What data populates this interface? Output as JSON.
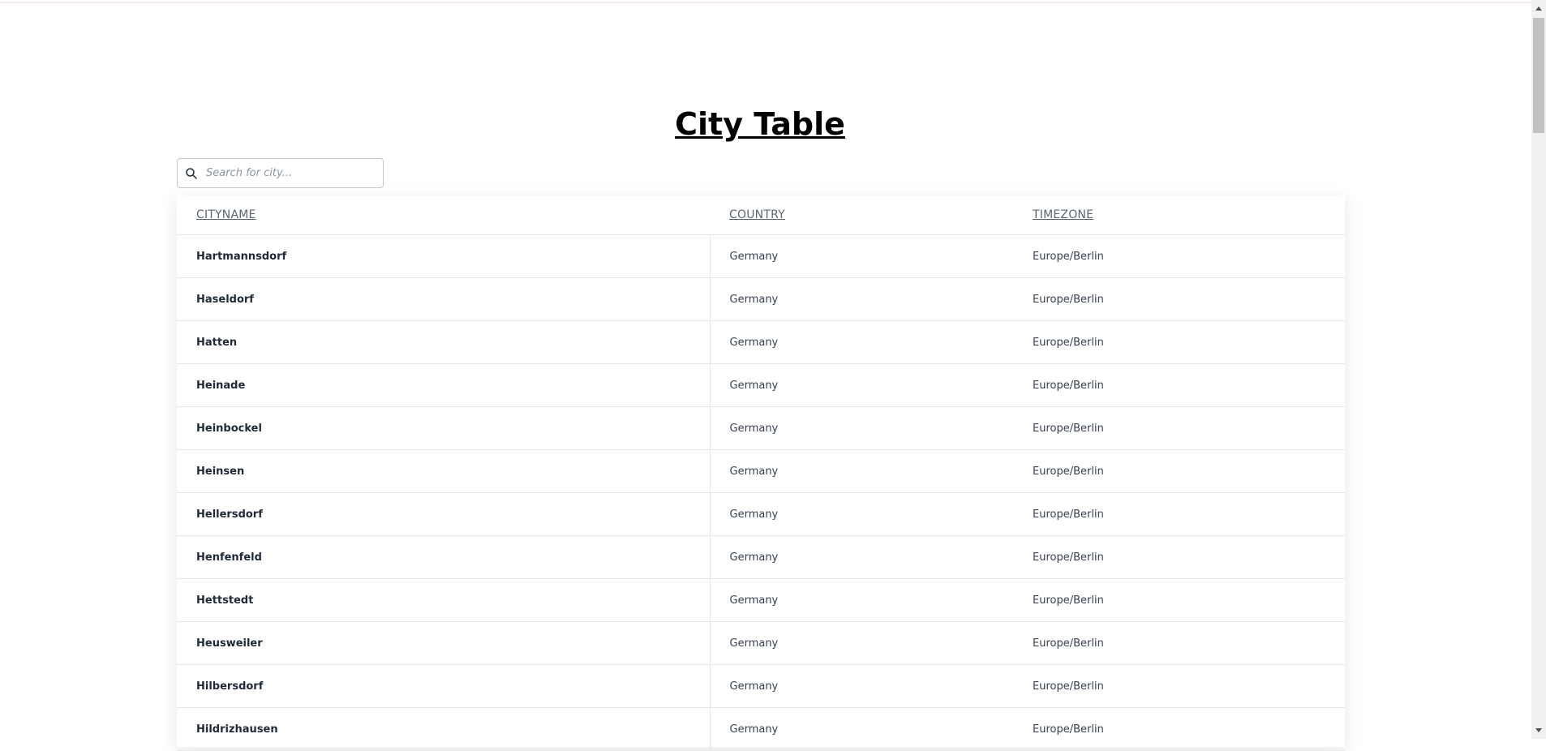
{
  "page": {
    "title": "City Table"
  },
  "search": {
    "placeholder": "Search for city...",
    "value": "",
    "icon": "search-icon"
  },
  "table": {
    "columns": [
      "CITYNAME",
      "COUNTRY",
      "TIMEZONE"
    ],
    "rows": [
      [
        "Hartmannsdorf",
        "Germany",
        "Europe/Berlin"
      ],
      [
        "Haseldorf",
        "Germany",
        "Europe/Berlin"
      ],
      [
        "Hatten",
        "Germany",
        "Europe/Berlin"
      ],
      [
        "Heinade",
        "Germany",
        "Europe/Berlin"
      ],
      [
        "Heinbockel",
        "Germany",
        "Europe/Berlin"
      ],
      [
        "Heinsen",
        "Germany",
        "Europe/Berlin"
      ],
      [
        "Hellersdorf",
        "Germany",
        "Europe/Berlin"
      ],
      [
        "Henfenfeld",
        "Germany",
        "Europe/Berlin"
      ],
      [
        "Hettstedt",
        "Germany",
        "Europe/Berlin"
      ],
      [
        "Heusweiler",
        "Germany",
        "Europe/Berlin"
      ],
      [
        "Hilbersdorf",
        "Germany",
        "Europe/Berlin"
      ],
      [
        "Hildrizhausen",
        "Germany",
        "Europe/Berlin"
      ]
    ]
  },
  "colors": {
    "title": "#000000",
    "header_text": "#5b6472",
    "cell_text": "#374151",
    "border": "#e5e7eb"
  }
}
